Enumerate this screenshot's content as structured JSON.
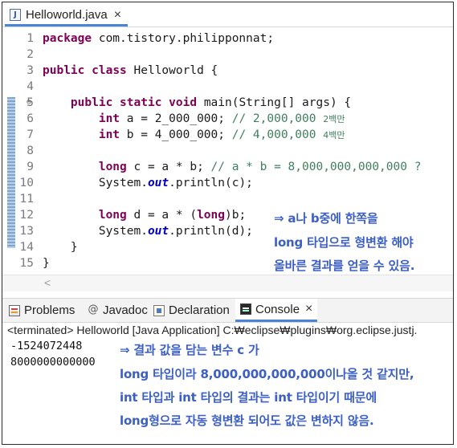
{
  "editor_tab": {
    "title": "Helloworld.java",
    "close": "×",
    "file_icon_letter": "J"
  },
  "code_lines": [
    {
      "n": "1",
      "parts": [
        {
          "t": "package",
          "c": "kw"
        },
        {
          "t": " com.tistory.philipponnat;",
          "c": ""
        }
      ]
    },
    {
      "n": "2",
      "parts": []
    },
    {
      "n": "3",
      "parts": [
        {
          "t": "public",
          "c": "kw"
        },
        {
          "t": " ",
          "c": ""
        },
        {
          "t": "class",
          "c": "kw"
        },
        {
          "t": " Helloworld {",
          "c": ""
        }
      ]
    },
    {
      "n": "4",
      "parts": []
    },
    {
      "n": "5",
      "parts": [
        {
          "t": "    ",
          "c": ""
        },
        {
          "t": "public",
          "c": "kw"
        },
        {
          "t": " ",
          "c": ""
        },
        {
          "t": "static",
          "c": "kw"
        },
        {
          "t": " ",
          "c": ""
        },
        {
          "t": "void",
          "c": "kw"
        },
        {
          "t": " main(String[] args) {",
          "c": ""
        }
      ]
    },
    {
      "n": "6",
      "parts": [
        {
          "t": "        ",
          "c": ""
        },
        {
          "t": "int",
          "c": "kw"
        },
        {
          "t": " a = 2_000_000; ",
          "c": ""
        },
        {
          "t": "// 2,000,000 ",
          "c": "cm"
        },
        {
          "t": "2백만",
          "c": "cm kor"
        }
      ]
    },
    {
      "n": "7",
      "parts": [
        {
          "t": "        ",
          "c": ""
        },
        {
          "t": "int",
          "c": "kw"
        },
        {
          "t": " b = 4_000_000; ",
          "c": ""
        },
        {
          "t": "// 4,000,000 ",
          "c": "cm"
        },
        {
          "t": "4백만",
          "c": "cm kor"
        }
      ]
    },
    {
      "n": "8",
      "parts": []
    },
    {
      "n": "9",
      "parts": [
        {
          "t": "        ",
          "c": ""
        },
        {
          "t": "long",
          "c": "kw"
        },
        {
          "t": " c = a * b; ",
          "c": ""
        },
        {
          "t": "// a * b = 8,000,000,000,000 ?",
          "c": "cm"
        }
      ]
    },
    {
      "n": "10",
      "parts": [
        {
          "t": "        System.",
          "c": ""
        },
        {
          "t": "out",
          "c": "it"
        },
        {
          "t": ".println(c);",
          "c": ""
        }
      ]
    },
    {
      "n": "11",
      "parts": []
    },
    {
      "n": "12",
      "parts": [
        {
          "t": "        ",
          "c": ""
        },
        {
          "t": "long",
          "c": "kw"
        },
        {
          "t": " d = a * (",
          "c": ""
        },
        {
          "t": "long",
          "c": "kw"
        },
        {
          "t": ")b;",
          "c": ""
        }
      ]
    },
    {
      "n": "13",
      "parts": [
        {
          "t": "        System.",
          "c": ""
        },
        {
          "t": "out",
          "c": "it"
        },
        {
          "t": ".println(d);",
          "c": ""
        }
      ]
    },
    {
      "n": "14",
      "parts": [
        {
          "t": "    }",
          "c": ""
        }
      ]
    },
    {
      "n": "15",
      "parts": [
        {
          "t": "}",
          "c": ""
        }
      ]
    }
  ],
  "fold_marker": "⊖",
  "editor_annotation": [
    "⇒ a나 b중에 한쪽을",
    "long 타입으로 형변환 해야",
    "올바른 결과를 얻을 수 있음."
  ],
  "panel_tabs": [
    {
      "label": "Problems",
      "icon": "problems-icon"
    },
    {
      "label": "Javadoc",
      "icon": "javadoc-icon"
    },
    {
      "label": "Declaration",
      "icon": "declaration-icon"
    },
    {
      "label": "Console",
      "icon": "console-icon",
      "active": true,
      "close": "×"
    }
  ],
  "terminated_text": "<terminated> Helloworld [Java Application] C:₩eclipse₩plugins₩org.eclipse.justj.",
  "console_lines": [
    "-1524072448",
    "8000000000000"
  ],
  "console_annotation": [
    "⇒ 결과 값을 담는 변수 c 가",
    "long 타입이라 8,000,000,000,000이나올 것 같지만,",
    "int 타입과 int 타입의 결과는 int 타입이기 때문에",
    "long형으로 자동 형변환 되어도 값은 변하지 않음."
  ],
  "colors": {
    "keyword": "#7f0055",
    "comment": "#3f7f5f",
    "annotation": "#3b5fc7",
    "tab_accent": "#4a84d4"
  }
}
